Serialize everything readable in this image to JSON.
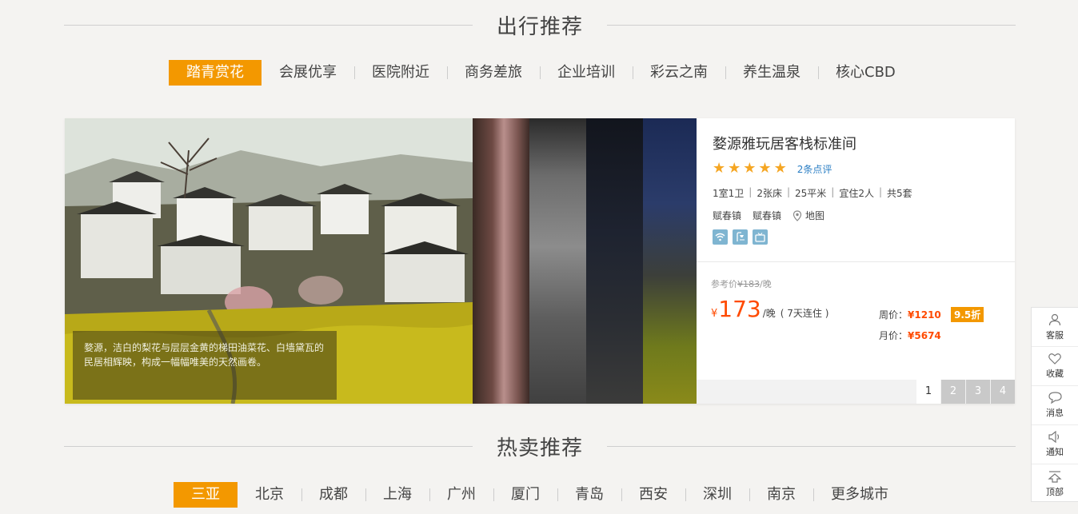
{
  "recommend": {
    "title": "出行推荐",
    "tabs": [
      "踏青赏花",
      "会展优享",
      "医院附近",
      "商务差旅",
      "企业培训",
      "彩云之南",
      "养生温泉",
      "核心CBD"
    ],
    "active_tab": 0
  },
  "feature": {
    "caption": "婺源，洁白的梨花与层层金黄的梯田油菜花、白墙黛瓦的民居相辉映，构成一幅幅唯美的天然画卷。",
    "hotel_name": "婺源雅玩居客栈标准间",
    "stars": 5,
    "reviews": "2条点评",
    "specs": [
      "1室1卫",
      "2张床",
      "25平米",
      "宜住2人",
      "共5套"
    ],
    "location": [
      "赋春镇",
      "赋春镇"
    ],
    "map_label": "地图",
    "amenities": [
      "wifi-icon",
      "shower-icon",
      "tv-icon"
    ],
    "ref_price_label": "参考价",
    "ref_price_currency": "¥",
    "ref_price": "183",
    "ref_price_unit": "/晚",
    "price_currency": "¥",
    "price": "173",
    "price_unit": "/晚",
    "stay_note": "( 7天连住 )",
    "weekly_label": "周价：",
    "weekly_price": "¥1210",
    "monthly_label": "月价：",
    "monthly_price": "¥5674",
    "discount": "9.5折",
    "pages": [
      "1",
      "2",
      "3",
      "4"
    ],
    "current_page": 0
  },
  "hot": {
    "title": "热卖推荐",
    "tabs": [
      "三亚",
      "北京",
      "成都",
      "上海",
      "广州",
      "厦门",
      "青岛",
      "西安",
      "深圳",
      "南京",
      "更多城市"
    ],
    "active_tab": 0
  },
  "sidebar": {
    "items": [
      {
        "label": "客服",
        "icon": "user-icon"
      },
      {
        "label": "收藏",
        "icon": "heart-icon"
      },
      {
        "label": "消息",
        "icon": "chat-icon"
      },
      {
        "label": "通知",
        "icon": "speaker-icon"
      },
      {
        "label": "顶部",
        "icon": "back-to-top-icon"
      }
    ]
  },
  "colors": {
    "accent": "#f39800",
    "price": "#ff4a00",
    "link": "#2a7ec4",
    "amenity": "#7fb5d1"
  }
}
